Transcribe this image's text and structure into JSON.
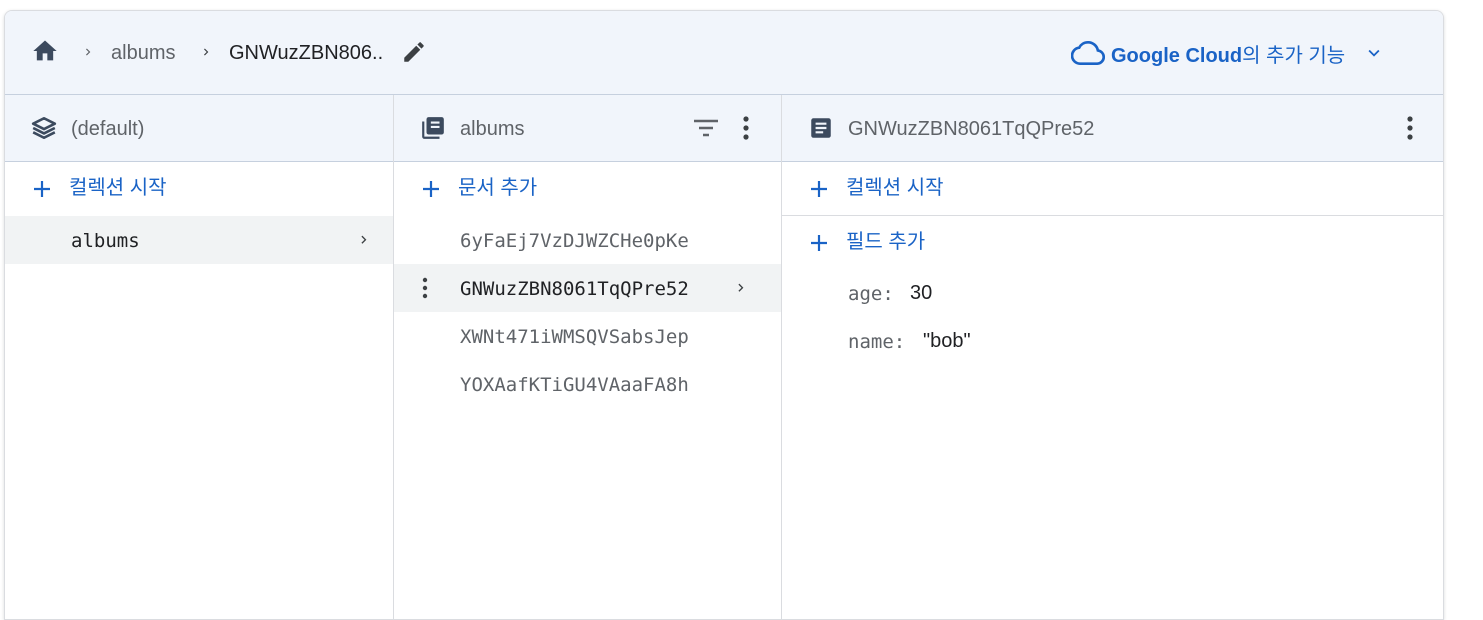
{
  "breadcrumb": {
    "home_icon": "home-icon",
    "items": [
      "albums",
      "GNWuzZBN806.."
    ],
    "edit_icon": "pencil-icon"
  },
  "google_cloud": {
    "brand": "Google Cloud",
    "suffix": "의 추가 기능",
    "icon": "cloud-icon",
    "accent": "#1a63c6"
  },
  "columns": {
    "root": {
      "title": "(default)",
      "icon": "database-layers-icon",
      "add_label": "컬렉션 시작",
      "items": [
        {
          "label": "albums",
          "selected": true
        }
      ]
    },
    "collection": {
      "title": "albums",
      "icon": "collection-icon",
      "add_label": "문서 추가",
      "items": [
        {
          "label": "6yFaEj7VzDJWZCHe0pKe",
          "selected": false
        },
        {
          "label": "GNWuzZBN8061TqQPre52",
          "selected": true
        },
        {
          "label": "XWNt471iWMSQVSabsJep",
          "selected": false
        },
        {
          "label": "YOXAafKTiGU4VAaaFA8h",
          "selected": false
        }
      ]
    },
    "document": {
      "title": "GNWuzZBN8061TqQPre52",
      "icon": "document-icon",
      "add_collection_label": "컬렉션 시작",
      "add_field_label": "필드 추가",
      "fields": [
        {
          "key": "age:",
          "value": "30"
        },
        {
          "key": "name:",
          "value": "\"bob\""
        }
      ]
    }
  },
  "colors": {
    "header_bg": "#f1f5fb",
    "link_blue": "#1a63c6",
    "selected_row": "#f1f3f4"
  }
}
